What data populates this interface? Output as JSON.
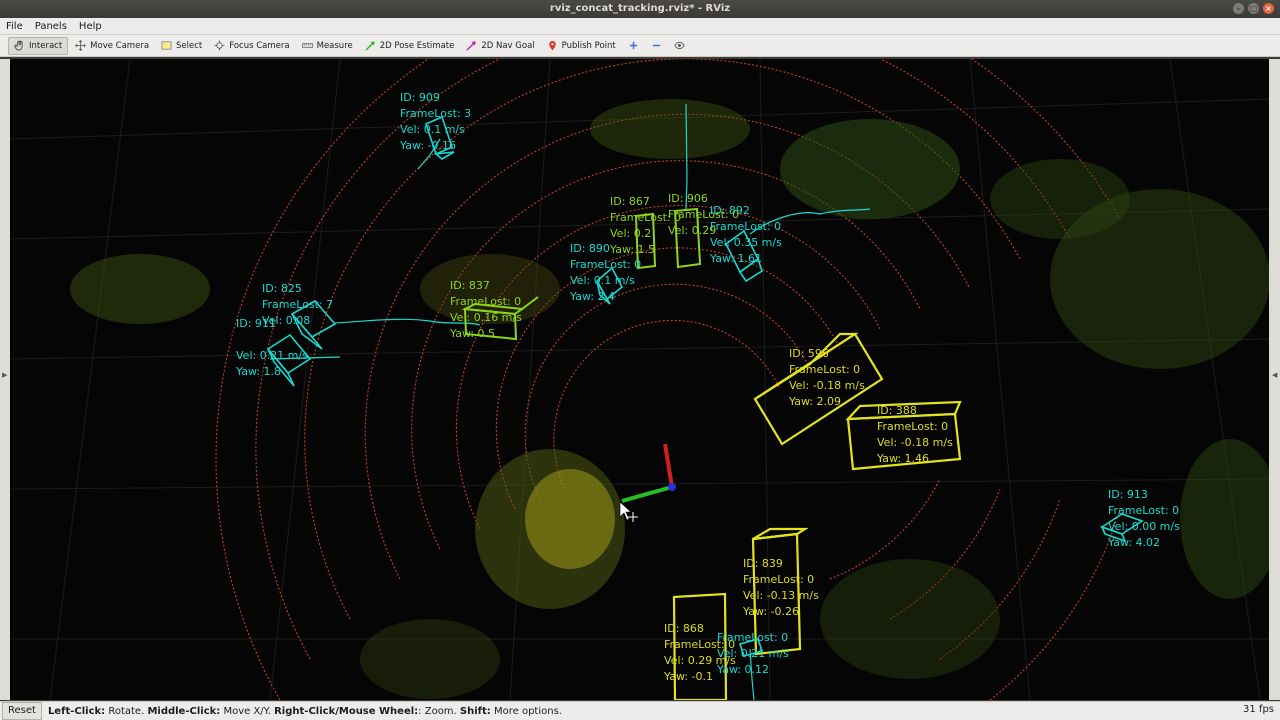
{
  "window": {
    "title": "rviz_concat_tracking.rviz* - RViz"
  },
  "menu": [
    "File",
    "Panels",
    "Help"
  ],
  "toolbar": {
    "tools": [
      {
        "label": "Interact",
        "icon": "hand-icon"
      },
      {
        "label": "Move Camera",
        "icon": "move-camera-icon"
      },
      {
        "label": "Select",
        "icon": "select-icon"
      },
      {
        "label": "Focus Camera",
        "icon": "focus-camera-icon"
      },
      {
        "label": "Measure",
        "icon": "measure-icon"
      },
      {
        "label": "2D Pose Estimate",
        "icon": "pose-estimate-icon"
      },
      {
        "label": "2D Nav Goal",
        "icon": "nav-goal-icon"
      },
      {
        "label": "Publish Point",
        "icon": "publish-point-icon"
      }
    ],
    "extra_icons": [
      "plus-icon",
      "minus-icon",
      "eye-icon"
    ]
  },
  "tracks": {
    "t909": {
      "l1": "ID:  909",
      "l2": "FrameLost:  3",
      "l3": "Vel:  0.1 m/s",
      "l4": "Yaw: -0.16"
    },
    "t825": {
      "l1": "ID:  825",
      "l2": "FrameLost:  7",
      "l3": "Vel:  0.08",
      "l4": ""
    },
    "t911": {
      "l1": "ID:  911",
      "l2": "",
      "l3": "Vel:  0.21 m/s",
      "l4": "Yaw:  1.8"
    },
    "t837": {
      "l1": "ID:  837",
      "l2": "FrameLost:  0",
      "l3": "Vel:  0.16 m/s",
      "l4": "Yaw:  0.5"
    },
    "t867": {
      "l1": "ID:  867",
      "l2": "FrameLost:  0",
      "l3": "Vel:  0.2",
      "l4": "Yaw:  1.5"
    },
    "t906": {
      "l1": "ID:  906",
      "l2": "FrameLost:  0",
      "l3": "Vel:  0.29",
      "l4": ""
    },
    "t890": {
      "l1": "ID:  890",
      "l2": "FrameLost:  0",
      "l3": "Vel:  0.1 m/s",
      "l4": "Yaw:  2.4"
    },
    "t892": {
      "l1": "ID:  892",
      "l2": "FrameLost:  0",
      "l3": "Vel:  0.35 m/s",
      "l4": "Yaw:  1.61"
    },
    "t596": {
      "l1": "ID:  596",
      "l2": "FrameLost:  0",
      "l3": "Vel:  -0.18 m/s",
      "l4": "Yaw:  2.09"
    },
    "t388": {
      "l1": "ID:  388",
      "l2": "FrameLost:  0",
      "l3": "Vel:  -0.18  m/s",
      "l4": "Yaw:  1.46"
    },
    "t913": {
      "l1": "ID:  913",
      "l2": "FrameLost:  0",
      "l3": "Vel:  0.00  m/s",
      "l4": "Yaw:  4.02"
    },
    "t839": {
      "l1": "ID:  839",
      "l2": "FrameLost:  0",
      "l3": "Vel:  -0.13  m/s",
      "l4": "Yaw:  -0.26"
    },
    "t868": {
      "l1": "ID:  868",
      "l2": "FrameLost:  0",
      "l3": "Vel:  0.29  m/s",
      "l4": "Yaw:  -0.1"
    },
    "t_small": {
      "l1": "",
      "l2": "FrameLost:  0",
      "l3": "Vel:  0.21  m/s",
      "l4": "Yaw:  0.12"
    }
  },
  "status": {
    "reset": "Reset",
    "left_click": "Left-Click:",
    "left_click_desc": " Rotate. ",
    "middle_click": "Middle-Click:",
    "middle_click_desc": " Move X/Y. ",
    "right_click": "Right-Click/Mouse Wheel:",
    "right_click_desc": ": Zoom. ",
    "shift": "Shift:",
    "shift_desc": " More options.",
    "fps": "31 fps"
  },
  "colors": {
    "cyan": "#17d9cf",
    "lime": "#8ed41d",
    "yellow": "#dddb22",
    "background": "#050505"
  }
}
